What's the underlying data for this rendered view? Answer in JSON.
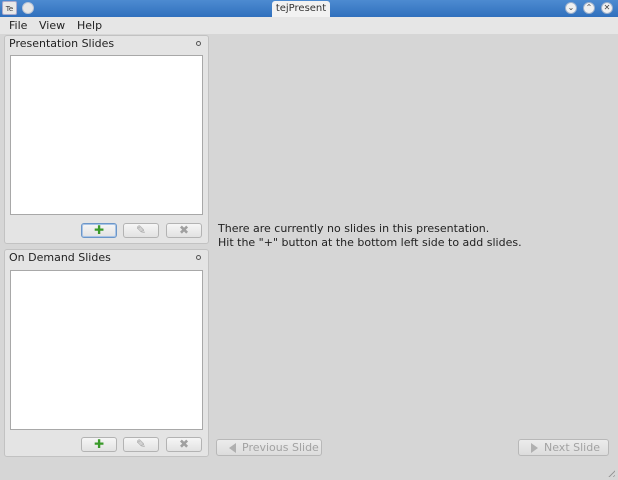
{
  "window": {
    "title": "tejPresent",
    "app_icon_label": "Te"
  },
  "menu": {
    "items": [
      "File",
      "View",
      "Help"
    ]
  },
  "presentation_panel": {
    "title": "Presentation Slides",
    "add_symbol": "✚",
    "edit_symbol": "✎",
    "remove_symbol": "✖"
  },
  "on_demand_panel": {
    "title": "On Demand Slides",
    "add_symbol": "✚",
    "edit_symbol": "✎",
    "remove_symbol": "✖"
  },
  "main": {
    "message_line1": "There are currently no slides in this presentation.",
    "message_line2": "Hit the \"+\" button at the bottom left side to add slides.",
    "previous_label": "Previous Slide",
    "next_label": "Next Slide"
  },
  "colors": {
    "titlebar": "#3f7fc8",
    "add_green": "#3a9a2a"
  }
}
